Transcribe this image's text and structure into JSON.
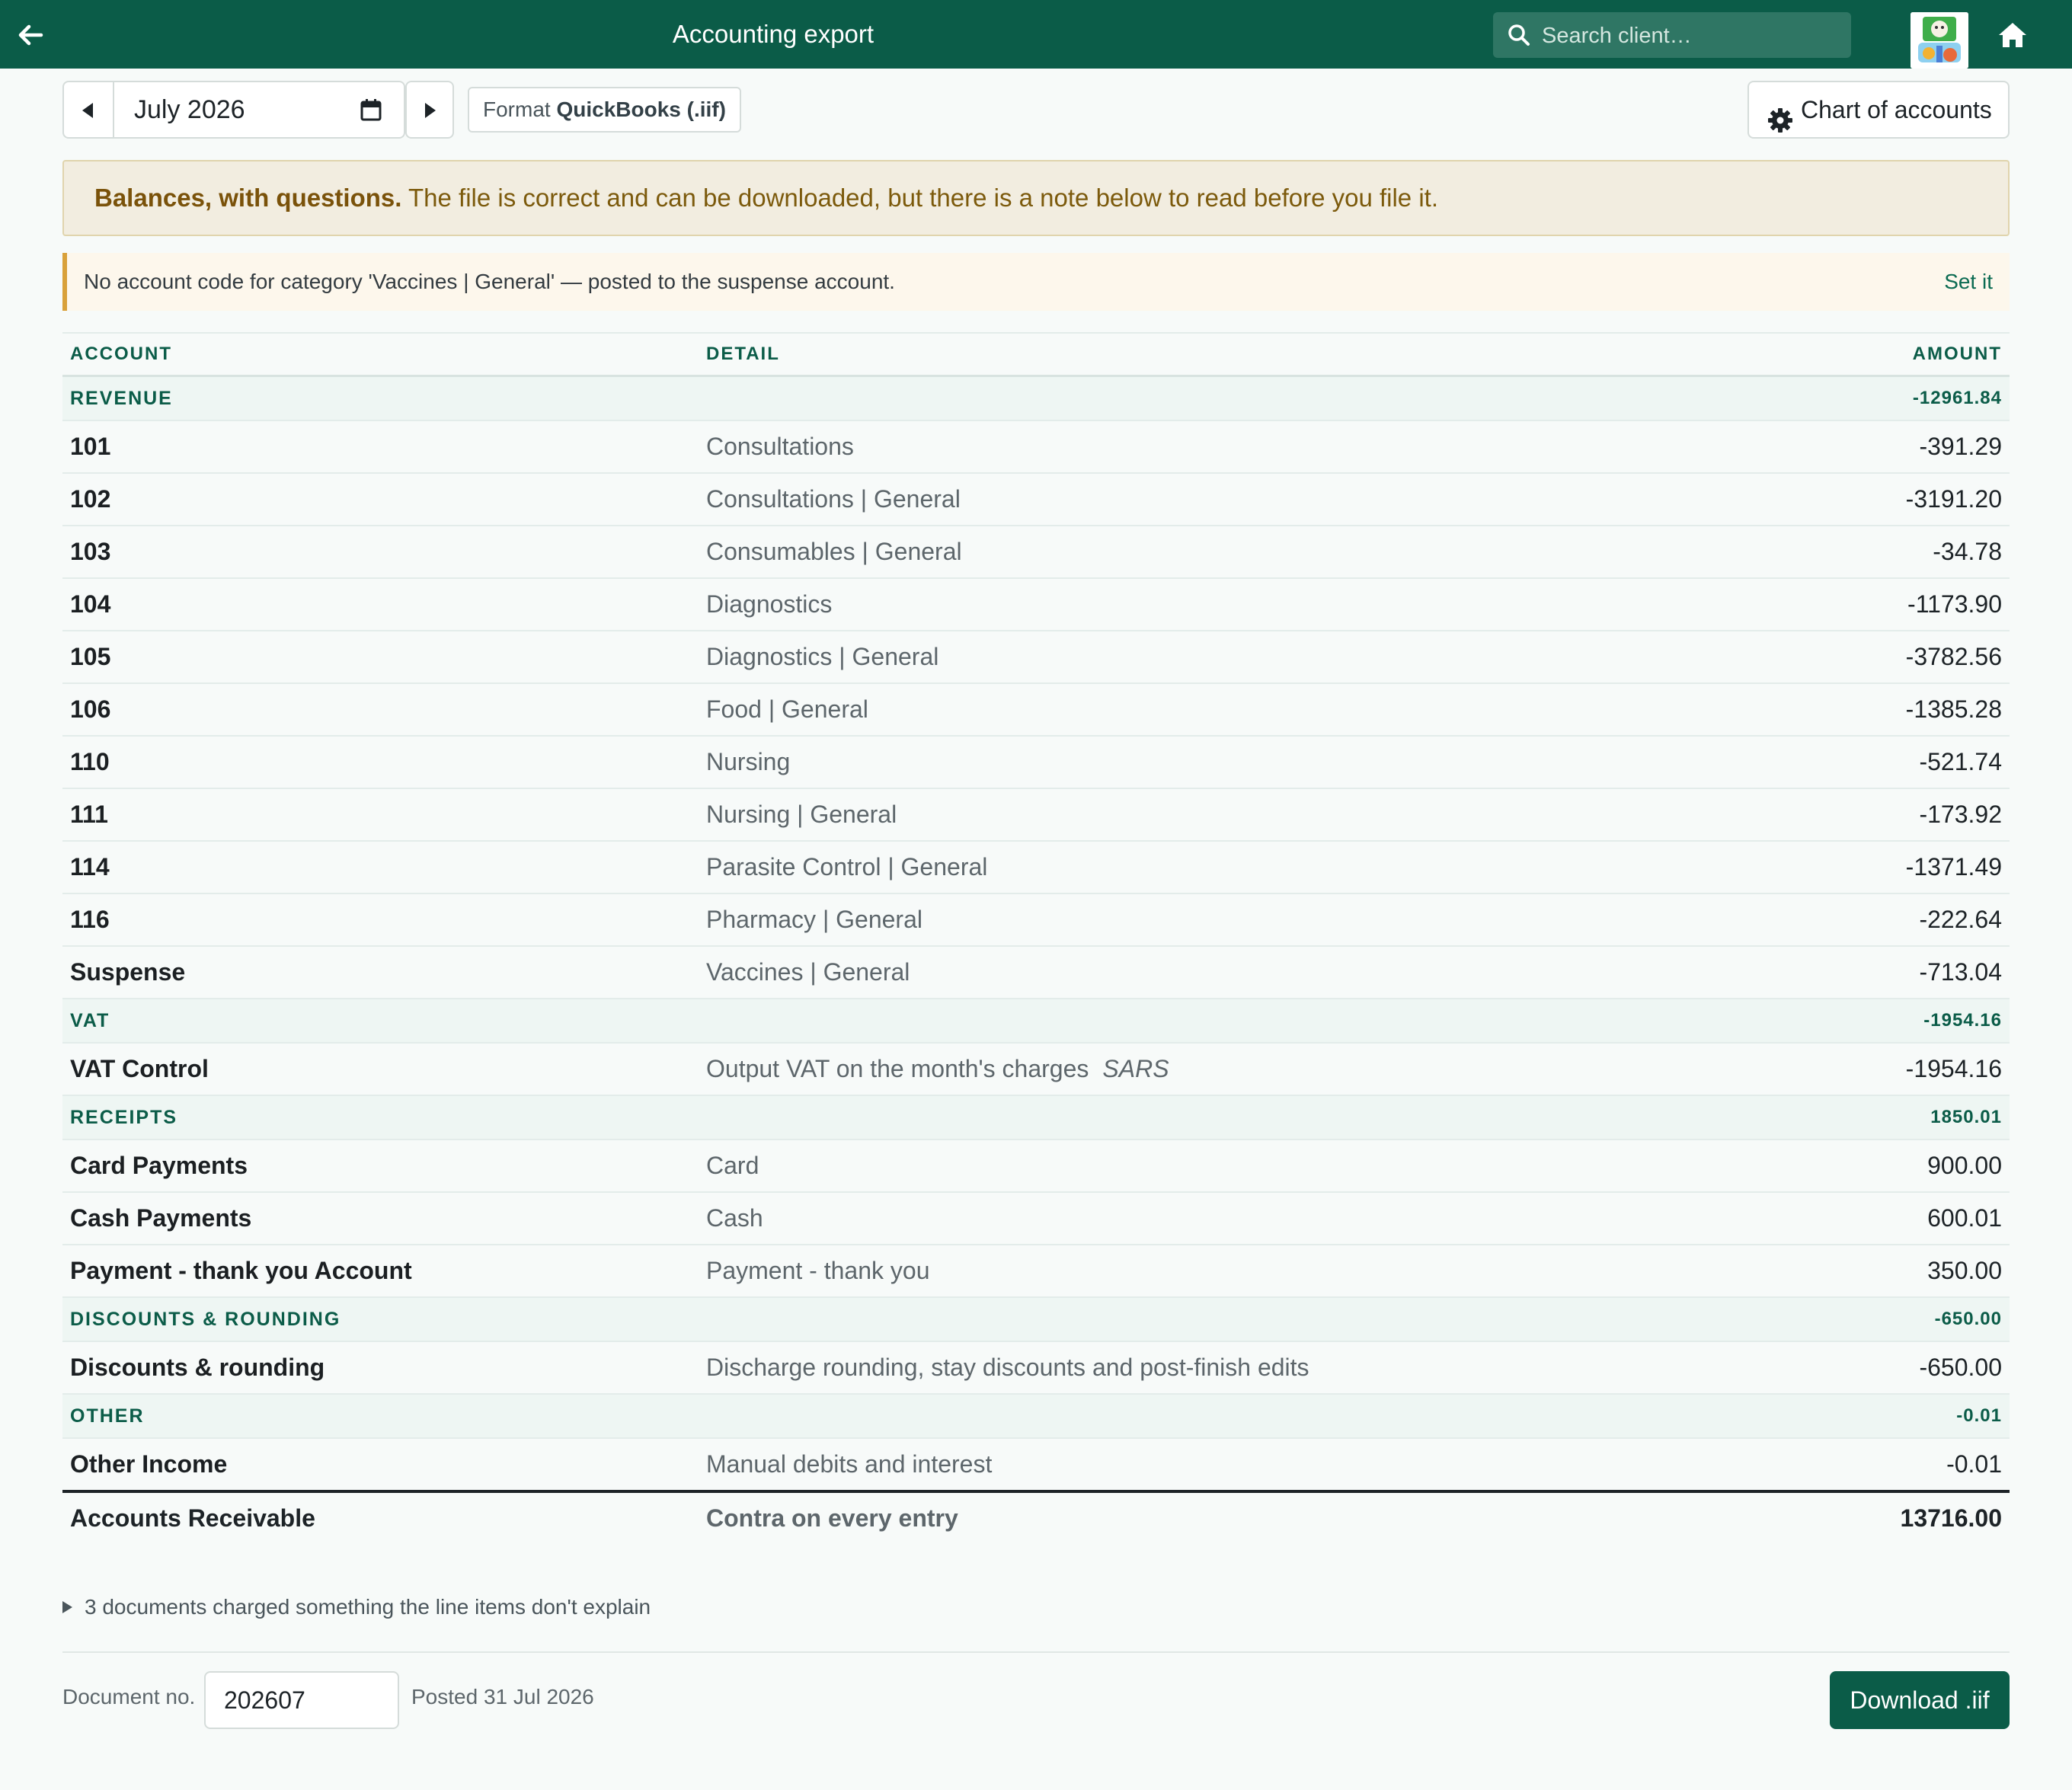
{
  "header": {
    "title": "Accounting export",
    "search_placeholder": "Search client…",
    "colors": {
      "bar": "#0b5c48",
      "accent": "#0b5c48"
    }
  },
  "toolbar": {
    "month": "July 2026",
    "format_prefix": "Format ",
    "format_name": "QuickBooks (.iif)",
    "chart_of_accounts": "Chart of accounts"
  },
  "status": {
    "title": "Balances, with questions.",
    "message": " The file is correct and can be downloaded, but there is a note below to read before you file it."
  },
  "note": {
    "text": "No account code for category 'Vaccines | General' — posted to the suspense account.",
    "action": "Set it"
  },
  "table": {
    "headers": {
      "account": "ACCOUNT",
      "detail": "DETAIL",
      "amount": "AMOUNT"
    },
    "groups": [
      {
        "name": "REVENUE",
        "total": "-12961.84",
        "rows": [
          {
            "account": "101",
            "detail": "Consultations",
            "amount": "-391.29"
          },
          {
            "account": "102",
            "detail": "Consultations | General",
            "amount": "-3191.20"
          },
          {
            "account": "103",
            "detail": "Consumables | General",
            "amount": "-34.78"
          },
          {
            "account": "104",
            "detail": "Diagnostics",
            "amount": "-1173.90"
          },
          {
            "account": "105",
            "detail": "Diagnostics | General",
            "amount": "-3782.56"
          },
          {
            "account": "106",
            "detail": "Food | General",
            "amount": "-1385.28"
          },
          {
            "account": "110",
            "detail": "Nursing",
            "amount": "-521.74"
          },
          {
            "account": "111",
            "detail": "Nursing | General",
            "amount": "-173.92"
          },
          {
            "account": "114",
            "detail": "Parasite Control | General",
            "amount": "-1371.49"
          },
          {
            "account": "116",
            "detail": "Pharmacy | General",
            "amount": "-222.64"
          },
          {
            "account": "Suspense",
            "detail": "Vaccines | General",
            "amount": "-713.04"
          }
        ]
      },
      {
        "name": "VAT",
        "total": "-1954.16",
        "rows": [
          {
            "account": "VAT Control",
            "detail": "Output VAT on the month's charges",
            "tag": "SARS",
            "amount": "-1954.16"
          }
        ]
      },
      {
        "name": "RECEIPTS",
        "total": "1850.01",
        "rows": [
          {
            "account": "Card Payments",
            "detail": "Card",
            "amount": "900.00"
          },
          {
            "account": "Cash Payments",
            "detail": "Cash",
            "amount": "600.01"
          },
          {
            "account": "Payment - thank you Account",
            "detail": "Payment - thank you",
            "amount": "350.00"
          }
        ]
      },
      {
        "name": "DISCOUNTS & ROUNDING",
        "total": "-650.00",
        "rows": [
          {
            "account": "Discounts & rounding",
            "detail": "Discharge rounding, stay discounts and post-finish edits",
            "amount": "-650.00"
          }
        ]
      },
      {
        "name": "OTHER",
        "total": "-0.01",
        "rows": [
          {
            "account": "Other Income",
            "detail": "Manual debits and interest",
            "amount": "-0.01"
          }
        ]
      }
    ],
    "total": {
      "account": "Accounts Receivable",
      "detail": "Contra on every entry",
      "amount": "13716.00"
    }
  },
  "footer": {
    "disclosure": "3 documents charged something the line items don't explain",
    "doc_no_label": "Document no.",
    "doc_no_value": "202607",
    "posted": "Posted 31 Jul 2026",
    "download": "Download .iif"
  }
}
